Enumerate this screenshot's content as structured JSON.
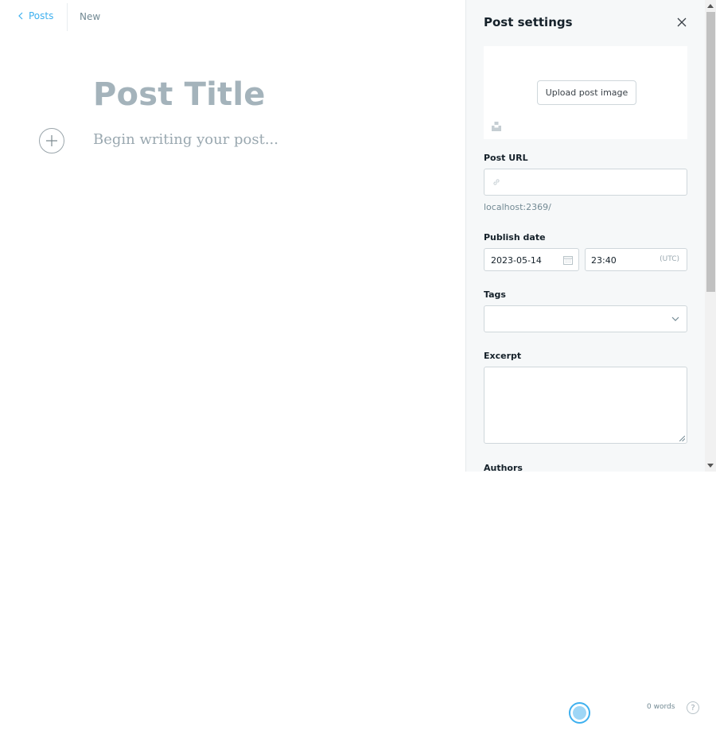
{
  "editor": {
    "back_label": "Posts",
    "status": "New",
    "title_placeholder": "Post Title",
    "body_placeholder": "Begin writing your post..."
  },
  "settings": {
    "title": "Post settings",
    "upload_label": "Upload post image",
    "url_label": "Post URL",
    "url_value": "",
    "url_hint": "localhost:2369/",
    "publish_label": "Publish date",
    "date_value": "2023-05-14",
    "time_value": "23:40",
    "timezone": "(UTC)",
    "tags_label": "Tags",
    "excerpt_label": "Excerpt",
    "authors_label": "Authors"
  },
  "footer": {
    "word_count": "0 words",
    "help": "?"
  },
  "colors": {
    "accent": "#3eb0ef",
    "panel_bg": "#f6f8f9"
  }
}
